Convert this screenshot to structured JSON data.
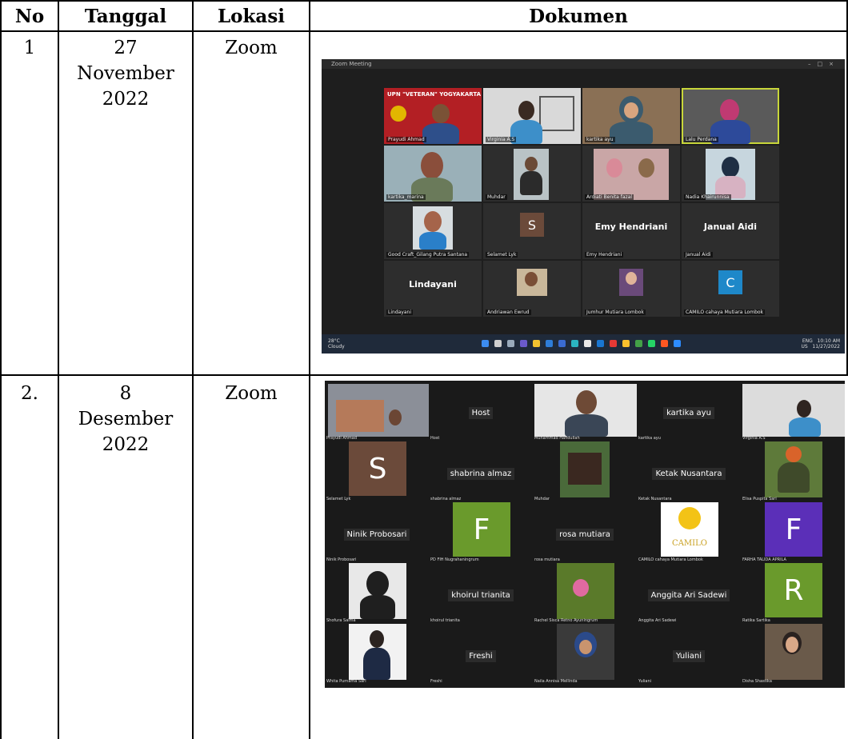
{
  "table": {
    "headers": [
      "No",
      "Tanggal",
      "Lokasi",
      "Dokumen"
    ],
    "rows": [
      {
        "no": "1",
        "date_lines": [
          "27",
          "November",
          "2022"
        ],
        "location": "Zoom"
      },
      {
        "no": "2.",
        "date_lines": [
          "8",
          "Desember",
          "2022"
        ],
        "location": "Zoom"
      }
    ]
  },
  "zoom1": {
    "window_title": "Zoom Meeting",
    "banner_text": "UPN \"VETERAN\" YOGYAKARTA",
    "tiles": [
      "Prayudi Ahmad",
      "Virginia A.S",
      "kartika ayu",
      "Lalu Perdana",
      "kartika_marina",
      "Muhdar",
      "Ardiati Benita fazal",
      "Nadia Khairunnisa",
      "Good Craft_Gilang Putra Santana",
      "Selamet Lyk",
      "Emy Hendriani",
      "Janual Aidi",
      "Lindayani",
      "Andriawan Ewrud",
      "Jumhur Mutiara Lombok",
      "CAMILO cahaya Mutiara Lombok"
    ],
    "big_labels": {
      "selamet_letter": "S",
      "emy": "Emy Hendriani",
      "janual": "Janual Aidi",
      "lindayani": "Lindayani",
      "camilo_letter": "C"
    },
    "taskbar": {
      "weather_temp": "28°C",
      "weather_desc": "Cloudy",
      "lang": "ENG",
      "region": "US",
      "time": "10:10 AM",
      "date": "11/27/2022"
    }
  },
  "zoom2": {
    "tiles": [
      {
        "name": "Prayudi Ahmad",
        "label": ""
      },
      {
        "name": "Host",
        "label": "Host"
      },
      {
        "name": "Muhammad Hafidullah",
        "label": ""
      },
      {
        "name": "kartika ayu",
        "label": "kartika ayu"
      },
      {
        "name": "Virginia A.S",
        "label": ""
      },
      {
        "name": "Selamet Lyk",
        "label": ""
      },
      {
        "name": "shabrina almaz",
        "label": "shabrina almaz"
      },
      {
        "name": "Muhdar",
        "label": ""
      },
      {
        "name": "Ketak Nusantara",
        "label": "Ketak Nusantara"
      },
      {
        "name": "Elisa Puspita Sari",
        "label": ""
      },
      {
        "name": "Ninik Probosari",
        "label": "Ninik Probosari"
      },
      {
        "name": "PD FIH Nugrahaningrum",
        "label": ""
      },
      {
        "name": "rosa mutiara",
        "label": "rosa mutiara"
      },
      {
        "name": "CAMILO cahaya Mutiara Lombok",
        "label": ""
      },
      {
        "name": "FARHA TALIDA APRILA",
        "label": ""
      },
      {
        "name": "Shofura Salma",
        "label": ""
      },
      {
        "name": "khoirul trianita",
        "label": "khoirul trianita"
      },
      {
        "name": "Rachel Sisca Retno Ayuningrum",
        "label": ""
      },
      {
        "name": "Anggita Ari Sadewi",
        "label": "Anggita Ari Sadewi"
      },
      {
        "name": "Ratika Sartika",
        "label": ""
      },
      {
        "name": "Whita Purnama Sari",
        "label": ""
      },
      {
        "name": "Freshi",
        "label": "Freshi"
      },
      {
        "name": "Naila Annisa Mellinda",
        "label": ""
      },
      {
        "name": "Yuliani",
        "label": "Yuliani"
      },
      {
        "name": "Disha Shastika",
        "label": ""
      }
    ],
    "letters": {
      "s": "S",
      "f1": "F",
      "f2": "F",
      "r": "R"
    },
    "camilo_logo_text": "CAMILO"
  },
  "colors": {
    "border": "#000000",
    "zoom_bg": "#1e1e1e",
    "taskbar": "#1f2a3a",
    "active_speaker": "#c8d63a",
    "avatar_brown": "#6b4a3a",
    "avatar_blue": "#1e88c9",
    "avatar_green": "#6a9a2c",
    "avatar_purple": "#5b2fb8"
  }
}
